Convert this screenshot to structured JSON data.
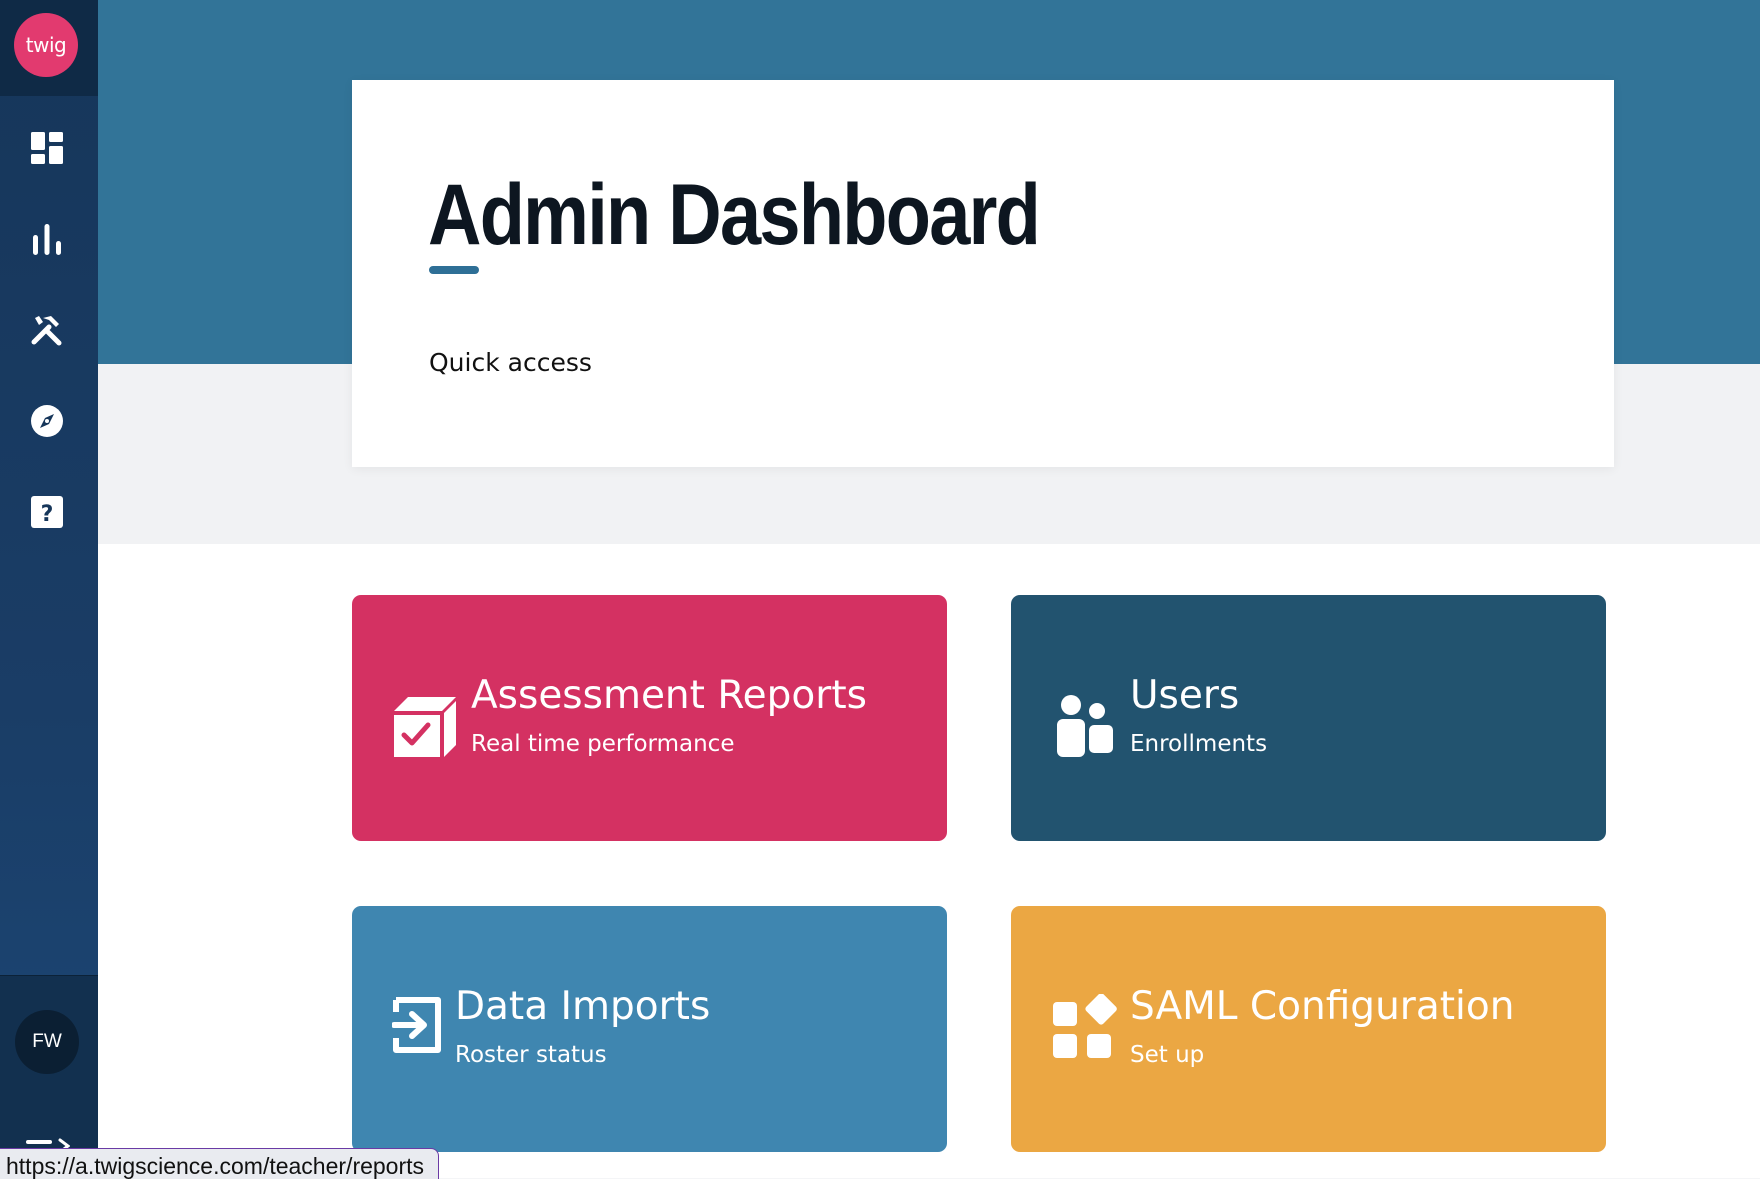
{
  "sidebar": {
    "logo_text": "twig",
    "items": [
      {
        "icon": "dashboard-icon"
      },
      {
        "icon": "bar-chart-icon"
      },
      {
        "icon": "tools-icon"
      },
      {
        "icon": "compass-icon"
      },
      {
        "icon": "help-icon"
      }
    ],
    "user_initials": "FW",
    "collapse_icon": "collapse-menu-icon"
  },
  "header": {
    "title": "Admin Dashboard",
    "subtitle": "Quick access"
  },
  "tiles": [
    {
      "title": "Assessment Reports",
      "subtitle": "Real time performance",
      "icon": "assessment-box-icon",
      "color": "#d43162"
    },
    {
      "title": "Users",
      "subtitle": "Enrollments",
      "icon": "users-icon",
      "color": "#22536f"
    },
    {
      "title": "Data Imports",
      "subtitle": "Roster status",
      "icon": "import-icon",
      "color": "#3f86b0"
    },
    {
      "title": "SAML Configuration",
      "subtitle": "Set up",
      "icon": "widgets-icon",
      "color": "#eba743"
    }
  ],
  "status_bar": {
    "url": "https://a.twigscience.com/teacher/reports"
  },
  "colors": {
    "hero": "#327498",
    "sidebar": "#16365a",
    "accent": "#2e6f96"
  }
}
